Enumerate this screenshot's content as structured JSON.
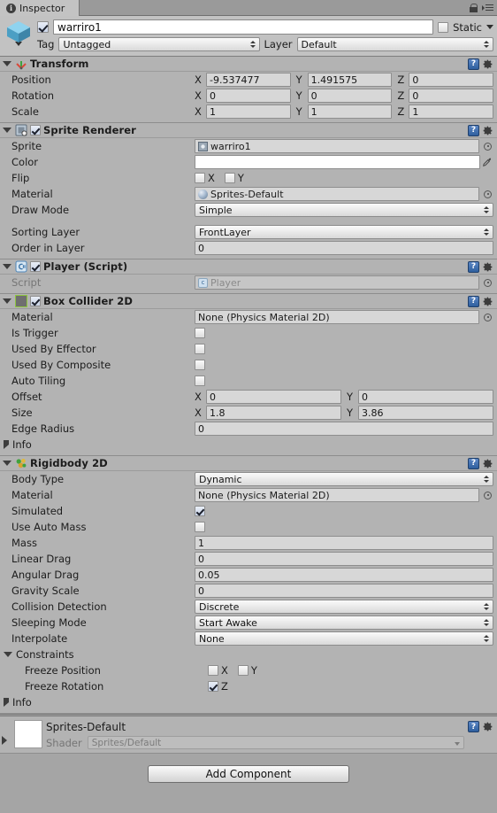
{
  "window": {
    "tab_label": "Inspector",
    "tab_icon": "info-icon",
    "lock_icon": "lock-icon",
    "menu_icon": "hamburger-menu-icon"
  },
  "gameobject": {
    "icon": "gameobject-cube-icon",
    "active": true,
    "name": "warriro1",
    "static_label": "Static",
    "static_checked": false,
    "tag_label": "Tag",
    "tag_value": "Untagged",
    "layer_label": "Layer",
    "layer_value": "Default"
  },
  "components": [
    {
      "title": "Transform",
      "icon": "transform-axis-icon",
      "expanded": true,
      "has_enable_checkbox": false,
      "rows": [
        {
          "kind": "vector3",
          "label": "Position",
          "x": "-9.537477",
          "y": "1.491575",
          "z": "0"
        },
        {
          "kind": "vector3",
          "label": "Rotation",
          "x": "0",
          "y": "0",
          "z": "0"
        },
        {
          "kind": "vector3",
          "label": "Scale",
          "x": "1",
          "y": "1",
          "z": "1"
        }
      ]
    },
    {
      "title": "Sprite Renderer",
      "icon": "sprite-renderer-icon",
      "expanded": true,
      "has_enable_checkbox": true,
      "enabled": true,
      "rows": [
        {
          "kind": "object",
          "label": "Sprite",
          "value": "warriro1",
          "icon": "sprite-icon"
        },
        {
          "kind": "color",
          "label": "Color",
          "value": "#ffffff"
        },
        {
          "kind": "flip",
          "label": "Flip",
          "x_label": "X",
          "y_label": "Y",
          "x": false,
          "y": false
        },
        {
          "kind": "object",
          "label": "Material",
          "value": "Sprites-Default",
          "icon": "material-ball-icon"
        },
        {
          "kind": "popup",
          "label": "Draw Mode",
          "value": "Simple"
        },
        {
          "kind": "spacer"
        },
        {
          "kind": "popup",
          "label": "Sorting Layer",
          "value": "FrontLayer"
        },
        {
          "kind": "text",
          "label": "Order in Layer",
          "value": "0"
        }
      ]
    },
    {
      "title": "Player (Script)",
      "icon": "csharp-script-icon",
      "expanded": true,
      "has_enable_checkbox": true,
      "enabled": true,
      "rows": [
        {
          "kind": "object",
          "label": "Script",
          "value": "Player",
          "icon": "script-icon",
          "disabled": true
        }
      ]
    },
    {
      "title": "Box Collider 2D",
      "icon": "box-collider-2d-icon",
      "expanded": true,
      "has_enable_checkbox": true,
      "enabled": true,
      "rows": [
        {
          "kind": "object",
          "label": "Material",
          "value": "None (Physics Material 2D)"
        },
        {
          "kind": "check",
          "label": "Is Trigger",
          "value": false
        },
        {
          "kind": "check",
          "label": "Used By Effector",
          "value": false
        },
        {
          "kind": "check",
          "label": "Used By Composite",
          "value": false
        },
        {
          "kind": "check",
          "label": "Auto Tiling",
          "value": false
        },
        {
          "kind": "vector2",
          "label": "Offset",
          "x": "0",
          "y": "0"
        },
        {
          "kind": "vector2",
          "label": "Size",
          "x": "1.8",
          "y": "3.86"
        },
        {
          "kind": "text",
          "label": "Edge Radius",
          "value": "0"
        },
        {
          "kind": "foldout",
          "label": "Info",
          "expanded": false
        }
      ]
    },
    {
      "title": "Rigidbody 2D",
      "icon": "rigidbody-2d-icon",
      "expanded": true,
      "has_enable_checkbox": false,
      "rows": [
        {
          "kind": "popup",
          "label": "Body Type",
          "value": "Dynamic"
        },
        {
          "kind": "object",
          "label": "Material",
          "value": "None (Physics Material 2D)"
        },
        {
          "kind": "check",
          "label": "Simulated",
          "value": true
        },
        {
          "kind": "check",
          "label": "Use Auto Mass",
          "value": false
        },
        {
          "kind": "text",
          "label": "Mass",
          "value": "1"
        },
        {
          "kind": "text",
          "label": "Linear Drag",
          "value": "0"
        },
        {
          "kind": "text",
          "label": "Angular Drag",
          "value": "0.05"
        },
        {
          "kind": "text",
          "label": "Gravity Scale",
          "value": "0"
        },
        {
          "kind": "popup",
          "label": "Collision Detection",
          "value": "Discrete"
        },
        {
          "kind": "popup",
          "label": "Sleeping Mode",
          "value": "Start Awake"
        },
        {
          "kind": "popup",
          "label": "Interpolate",
          "value": "None"
        },
        {
          "kind": "foldout",
          "label": "Constraints",
          "expanded": true
        },
        {
          "kind": "freeze",
          "label": "Freeze Position",
          "indent": true,
          "a_label": "X",
          "a": false,
          "b_label": "Y",
          "b": false
        },
        {
          "kind": "freeze",
          "label": "Freeze Rotation",
          "indent": true,
          "a_label": "Z",
          "a": true
        },
        {
          "kind": "foldout",
          "label": "Info",
          "expanded": false
        }
      ]
    }
  ],
  "material_preview": {
    "name": "Sprites-Default",
    "shader_label": "Shader",
    "shader_value": "Sprites/Default",
    "expanded": false
  },
  "add_component": {
    "label": "Add Component"
  }
}
